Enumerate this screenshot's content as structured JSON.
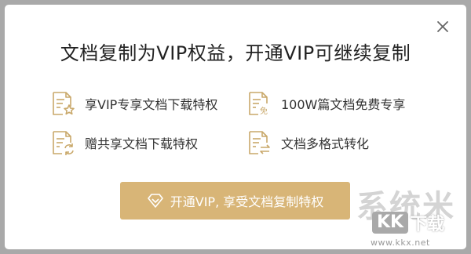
{
  "dialog": {
    "title": "文档复制为VIP权益，开通VIP可继续复制",
    "close_icon": "close-icon",
    "features": [
      {
        "label": "享VIP专享文档下载特权",
        "icon": "document-star-icon"
      },
      {
        "label": "100W篇文档免费专享",
        "icon": "document-free-icon"
      },
      {
        "label": "赠共享文档下载特权",
        "icon": "document-refresh-icon"
      },
      {
        "label": "文档多格式转化",
        "icon": "document-convert-icon"
      }
    ],
    "cta": {
      "label": "开通VIP, 享受文档复制特权",
      "icon": "diamond-icon"
    }
  },
  "watermark": {
    "brand": "系统米",
    "badge_main": "KK",
    "badge_sub": "下载",
    "url": "www.kkx.net"
  },
  "colors": {
    "gold": "#d8b577",
    "icon_gold": "#c9a86a",
    "title_text": "#222222",
    "body_text": "#333333",
    "overlay": "#a9a9a9"
  }
}
